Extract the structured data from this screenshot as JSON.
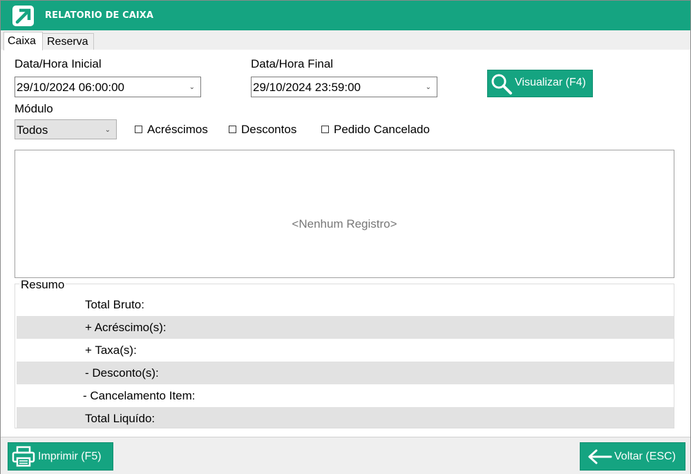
{
  "window": {
    "title": "RELATORIO DE CAIXA",
    "accent_color": "#15a481"
  },
  "tabs": [
    {
      "label": "Caixa",
      "active": true
    },
    {
      "label": "Reserva",
      "active": false
    }
  ],
  "filters": {
    "start_label": "Data/Hora Inicial",
    "start_value": "29/10/2024 06:00:00",
    "end_label": "Data/Hora Final",
    "end_value": "29/10/2024 23:59:00",
    "module_label": "Módulo",
    "module_value": "Todos",
    "view_button": "Visualizar (F4)",
    "checkboxes": [
      {
        "label": "Acréscimos",
        "checked": false
      },
      {
        "label": "Descontos",
        "checked": false
      },
      {
        "label": "Pedido Cancelado",
        "checked": false
      }
    ]
  },
  "grid": {
    "empty_text": "<Nenhum Registro>"
  },
  "summary": {
    "title": "Resumo",
    "rows": [
      {
        "label": "Total Bruto:"
      },
      {
        "label": "+ Acréscimo(s):"
      },
      {
        "label": "+ Taxa(s):"
      },
      {
        "label": "- Desconto(s):"
      },
      {
        "label": "- Cancelamento Item:"
      },
      {
        "label": "Total Liquído:"
      }
    ]
  },
  "footer": {
    "print_button": "Imprimir (F5)",
    "back_button": "Voltar (ESC)"
  }
}
